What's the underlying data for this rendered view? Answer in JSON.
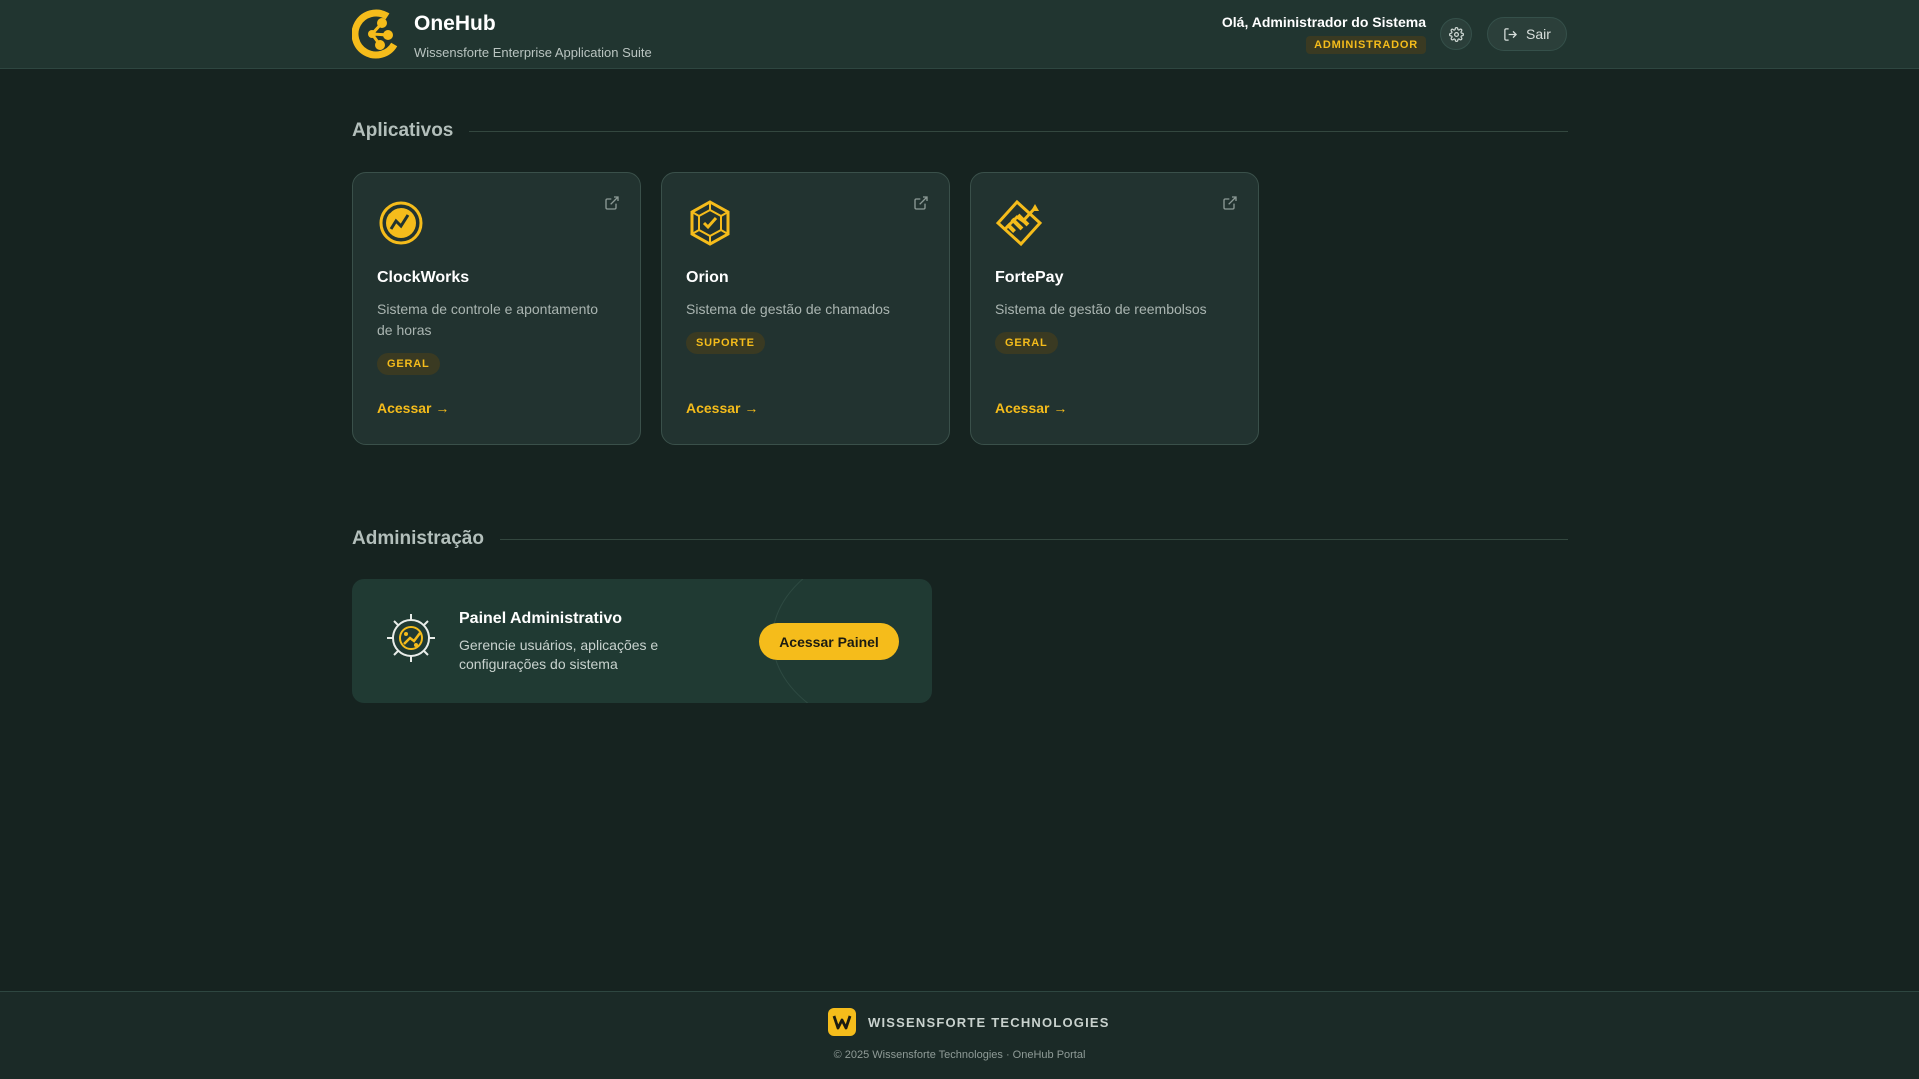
{
  "header": {
    "title": "OneHub",
    "subtitle": "Wissensforte Enterprise Application Suite",
    "greeting": "Olá, Administrador do Sistema",
    "role": "ADMINISTRADOR",
    "logout_label": "Sair"
  },
  "sections": {
    "apps_title": "Aplicativos",
    "admin_title": "Administração"
  },
  "apps": [
    {
      "name": "ClockWorks",
      "description": "Sistema de controle e apontamento de horas",
      "tag": "GERAL",
      "link": "Acessar →",
      "icon": "clock-chart-icon"
    },
    {
      "name": "Orion",
      "description": "Sistema de gestão de chamados",
      "tag": "SUPORTE",
      "link": "Acessar →",
      "icon": "hexagon-check-icon"
    },
    {
      "name": "FortePay",
      "description": "Sistema de gestão de reembolsos",
      "tag": "GERAL",
      "link": "Acessar →",
      "icon": "payment-chart-icon"
    }
  ],
  "admin": {
    "title": "Painel Administrativo",
    "description": "Gerencie usuários, aplicações e configurações do sistema",
    "button": "Acessar Painel"
  },
  "footer": {
    "company": "WISSENSFORTE TECHNOLOGIES",
    "copyright": "© 2025 Wissensforte Technologies · OneHub Portal"
  },
  "colors": {
    "accent": "#f5bc1b",
    "background": "#162320",
    "header": "#213530",
    "card": "#223330"
  }
}
